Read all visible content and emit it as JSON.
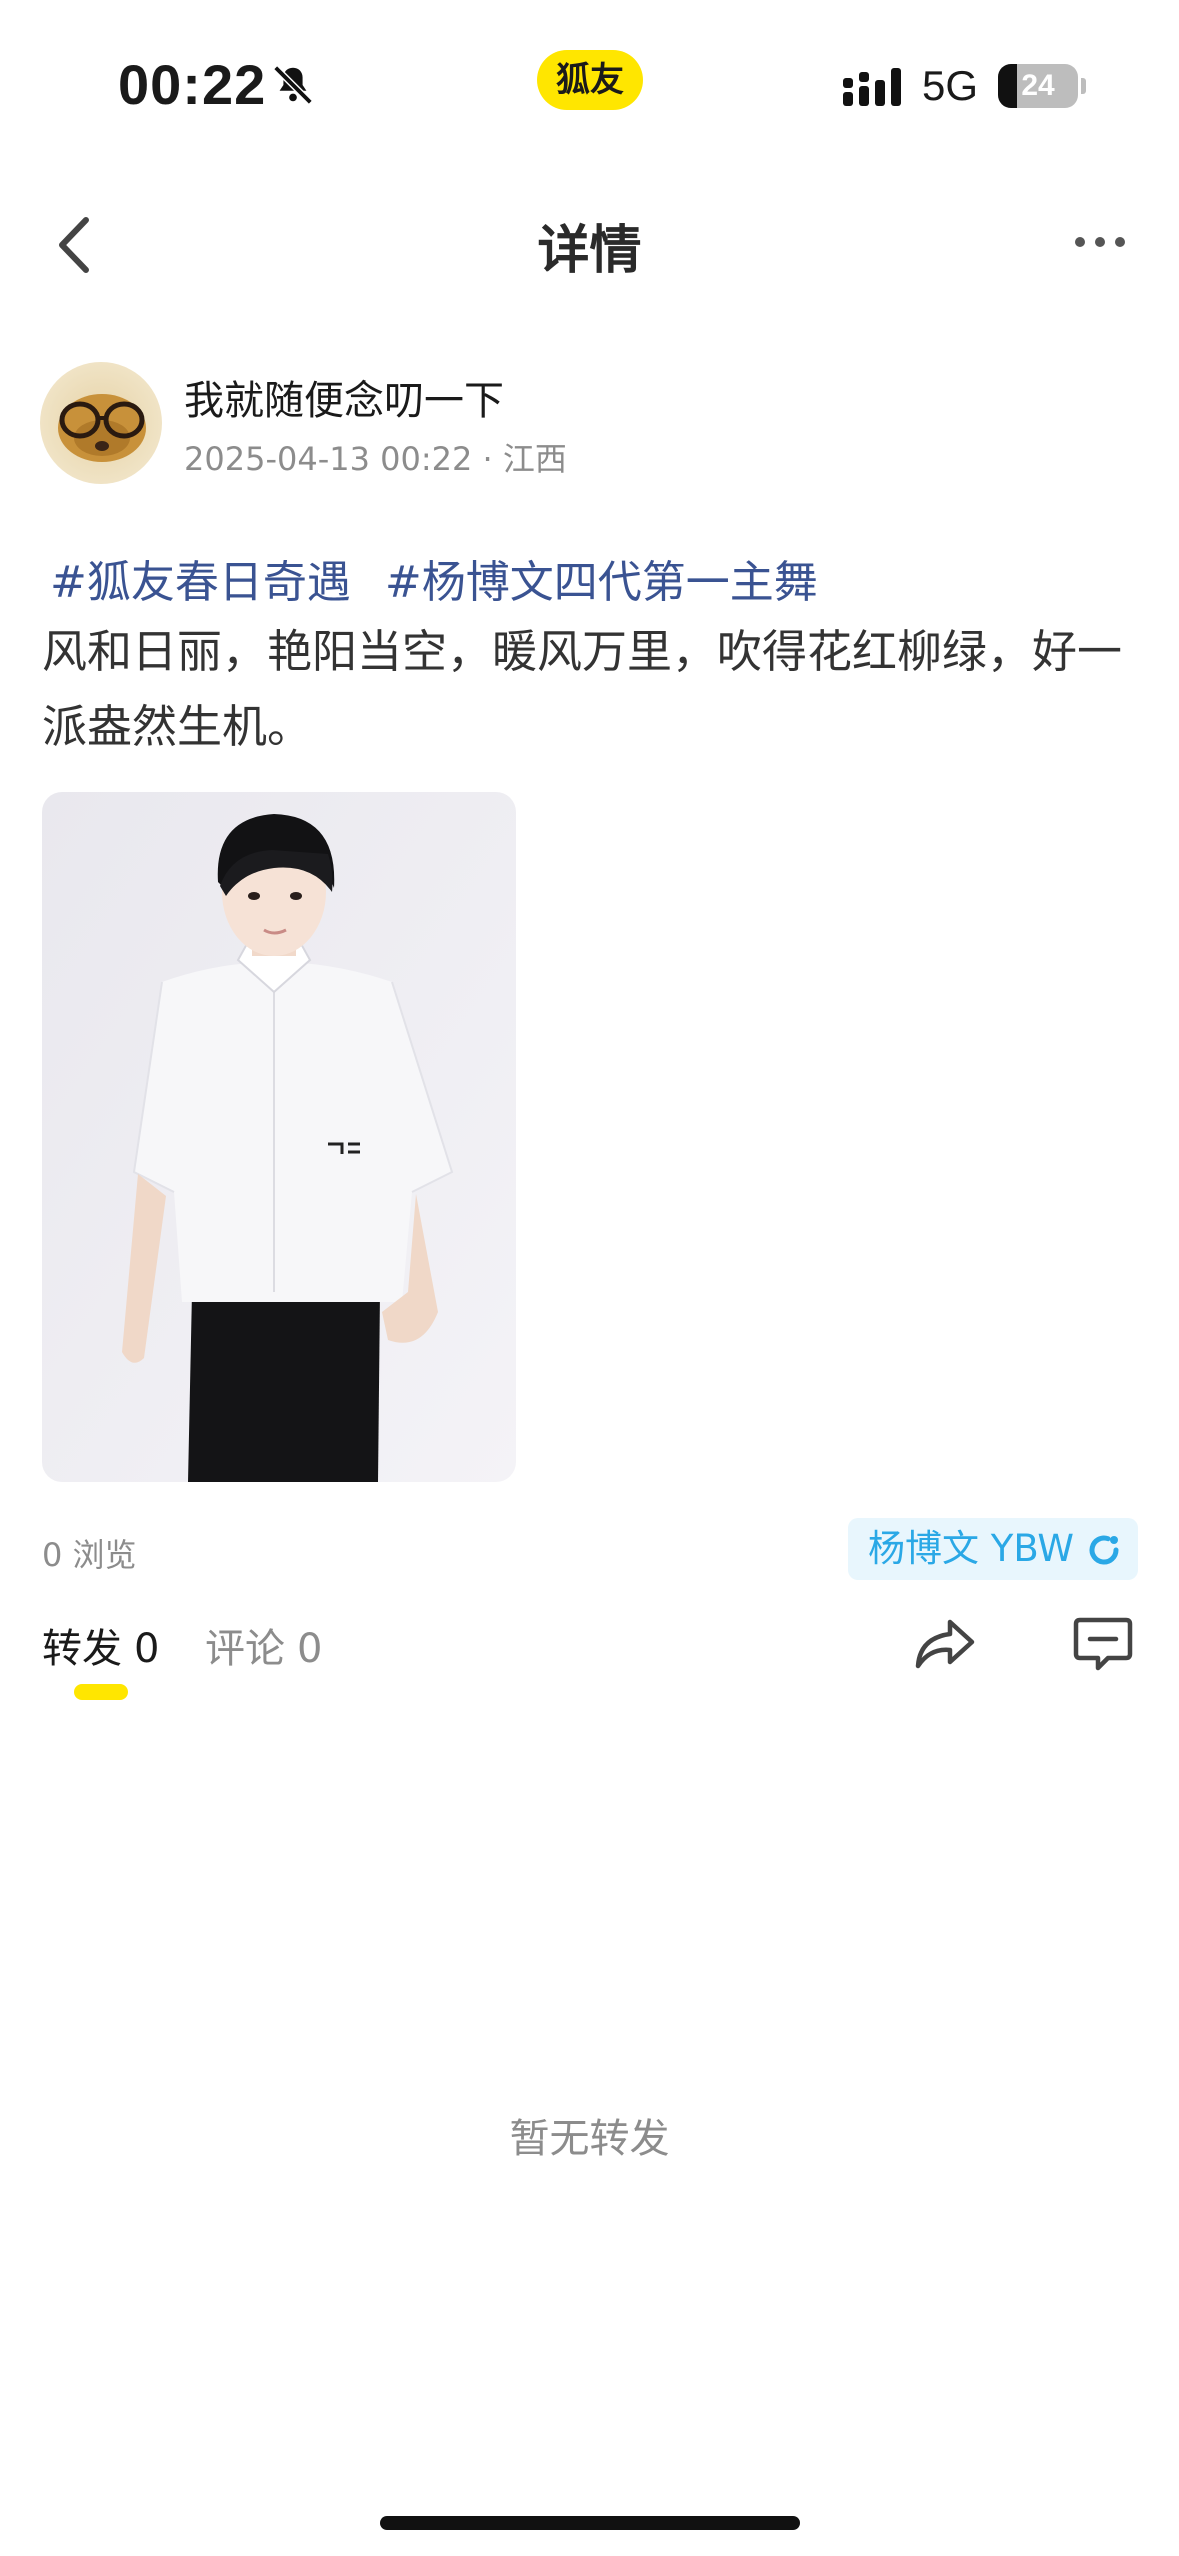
{
  "status_bar": {
    "time": "00:22",
    "app_badge": "狐友",
    "network": "5G",
    "battery_level": "24",
    "battery_fraction": 0.24,
    "icons": [
      "bell-muted-icon",
      "signal-icon",
      "battery-icon"
    ]
  },
  "nav": {
    "title": "详情",
    "back_icon": "chevron-left-icon",
    "more_icon": "more-dots-icon"
  },
  "author": {
    "name": "我就随便念叨一下",
    "meta": "2025-04-13 00:22 · 江西"
  },
  "post": {
    "hashtags": [
      "#狐友春日奇遇",
      "#杨博文四代第一主舞"
    ],
    "body": "风和日丽，艳阳当空，暖风万里，吹得花红柳绿，好一派盎然生机。"
  },
  "stats": {
    "views": "0 浏览",
    "topic_chip": "杨博文 YBW"
  },
  "tabs": {
    "forward_label": "转发",
    "forward_count": "0",
    "comment_label": "评论",
    "comment_count": "0"
  },
  "actions": {
    "share_icon": "share-icon",
    "comment_icon": "comment-bubble-icon"
  },
  "empty_state": "暂无转发",
  "colors": {
    "accent_yellow": "#ffe600",
    "hashtag_blue": "#3a5392",
    "chip_blue": "#2aa8e6",
    "chip_bg": "#e8f6fd",
    "muted_gray": "#8c8c8c"
  }
}
